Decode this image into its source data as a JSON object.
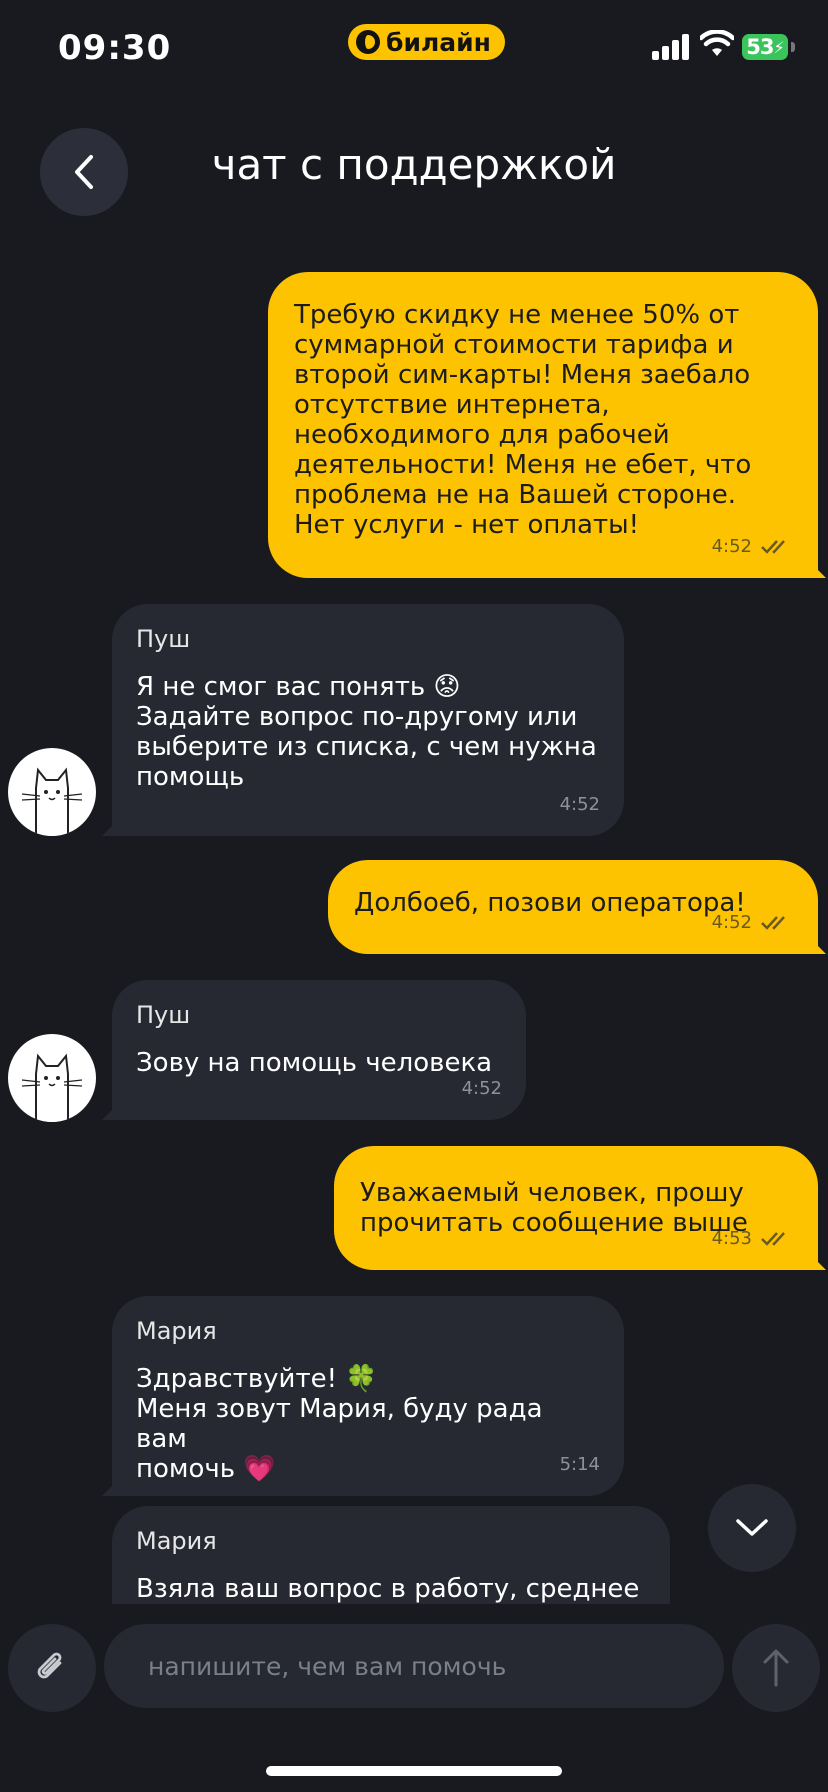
{
  "status_bar": {
    "time": "09:30",
    "carrier": "билайн",
    "battery": "53"
  },
  "header": {
    "title": "чат с поддержкой"
  },
  "messages": [
    {
      "direction": "out",
      "text": "Требую скидку не менее 50% от\nсуммарной стоимости тарифа и\nвторой сим-карты! Меня заебало\nотсутствие интернета,\nнеобходимого для рабочей\nдеятельности! Меня не ебет, что\nпроблема не на Вашей стороне.\nНет услуги - нет оплаты!",
      "time": "4:52",
      "status": "read"
    },
    {
      "direction": "in",
      "sender": "Пуш",
      "text": "Я не смог вас понять 😟\nЗадайте вопрос по-другому или\nвыберите из списка, с чем нужна\nпомощь",
      "time": "4:52"
    },
    {
      "direction": "out",
      "text": "Долбоеб, позови оператора!",
      "time": "4:52",
      "status": "read"
    },
    {
      "direction": "in",
      "sender": "Пуш",
      "text": "Зову на помощь человека",
      "time": "4:52"
    },
    {
      "direction": "out",
      "text": "Уважаемый человек, прошу\nпрочитать сообщение выше",
      "time": "4:53",
      "status": "read"
    },
    {
      "direction": "in",
      "sender": "Мария",
      "text": "Здравствуйте! 🍀\nМеня зовут Мария, буду рада вам\nпомочь 💗",
      "time": "5:14"
    },
    {
      "direction": "in",
      "sender": "Мария",
      "text": "Взяла ваш вопрос в работу, среднее"
    }
  ],
  "composer": {
    "placeholder": "напишите, чем вам помочь"
  },
  "colors": {
    "background": "#181a20",
    "accent": "#fdc300",
    "incoming_bubble": "#262932"
  },
  "icons": {
    "back": "chevron-left-icon",
    "scroll_down": "chevron-down-icon",
    "attach": "paperclip-icon",
    "send": "arrow-up-icon",
    "read_status": "double-check-icon"
  }
}
